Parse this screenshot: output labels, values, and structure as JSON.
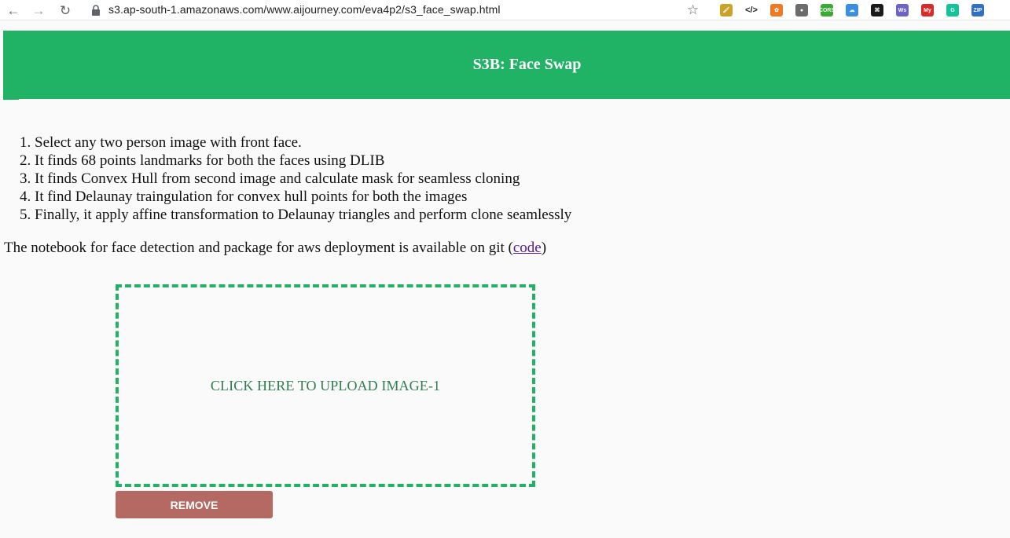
{
  "browser": {
    "url": "s3.ap-south-1.amazonaws.com/www.aijourney.com/eva4p2/s3_face_swap.html",
    "extensions": [
      {
        "name": "paint-brush-extension-icon",
        "color": "#c9a227",
        "label": "🖌"
      },
      {
        "name": "code-view-extension-icon",
        "color": "#ffffff",
        "label": "</>"
      },
      {
        "name": "orange-circle-extension-icon",
        "color": "#f07a22",
        "label": "✿"
      },
      {
        "name": "grey-circle-extension-icon",
        "color": "#6b6b6b",
        "label": "●"
      },
      {
        "name": "cors-extension-icon",
        "color": "#3aa935",
        "label": "CORS"
      },
      {
        "name": "cloud-extension-icon",
        "color": "#3b8fe0",
        "label": "☁"
      },
      {
        "name": "black-extension-icon",
        "color": "#1b1b1b",
        "label": "⌘"
      },
      {
        "name": "ws-extension-icon",
        "color": "#6c63c9",
        "label": "Ws"
      },
      {
        "name": "red-extension-icon",
        "color": "#d92a2a",
        "label": "My"
      },
      {
        "name": "grammarly-extension-icon",
        "color": "#15c39a",
        "label": "G"
      },
      {
        "name": "zip-extension-icon",
        "color": "#2f6fc4",
        "label": "ZIP"
      }
    ]
  },
  "header": {
    "title": "S3B: Face Swap"
  },
  "steps": [
    {
      "num": "1.",
      "text": "Select any two person image with front face."
    },
    {
      "num": "2.",
      "text": "It finds 68 points landmarks for both the faces using DLIB"
    },
    {
      "num": "3.",
      "text": "It finds Convex Hull from second image and calculate mask for seamless cloning"
    },
    {
      "num": "4.",
      "text": "It find Delaunay traingulation for convex hull points for both the images"
    },
    {
      "num": "5.",
      "text": "Finally, it apply affine transformation to Delaunay triangles and perform clone seamlessly"
    }
  ],
  "note": {
    "prefix": "The notebook for face detection and package for aws deployment is available on git (",
    "link_label": "code",
    "suffix": ")"
  },
  "upload": {
    "label": "CLICK HERE TO UPLOAD IMAGE-1"
  },
  "remove_button": {
    "label": "REMOVE"
  },
  "colors": {
    "accent": "#20b366",
    "remove": "#b46a62",
    "upload_text": "#2e7d4f",
    "link": "#551a8b"
  }
}
